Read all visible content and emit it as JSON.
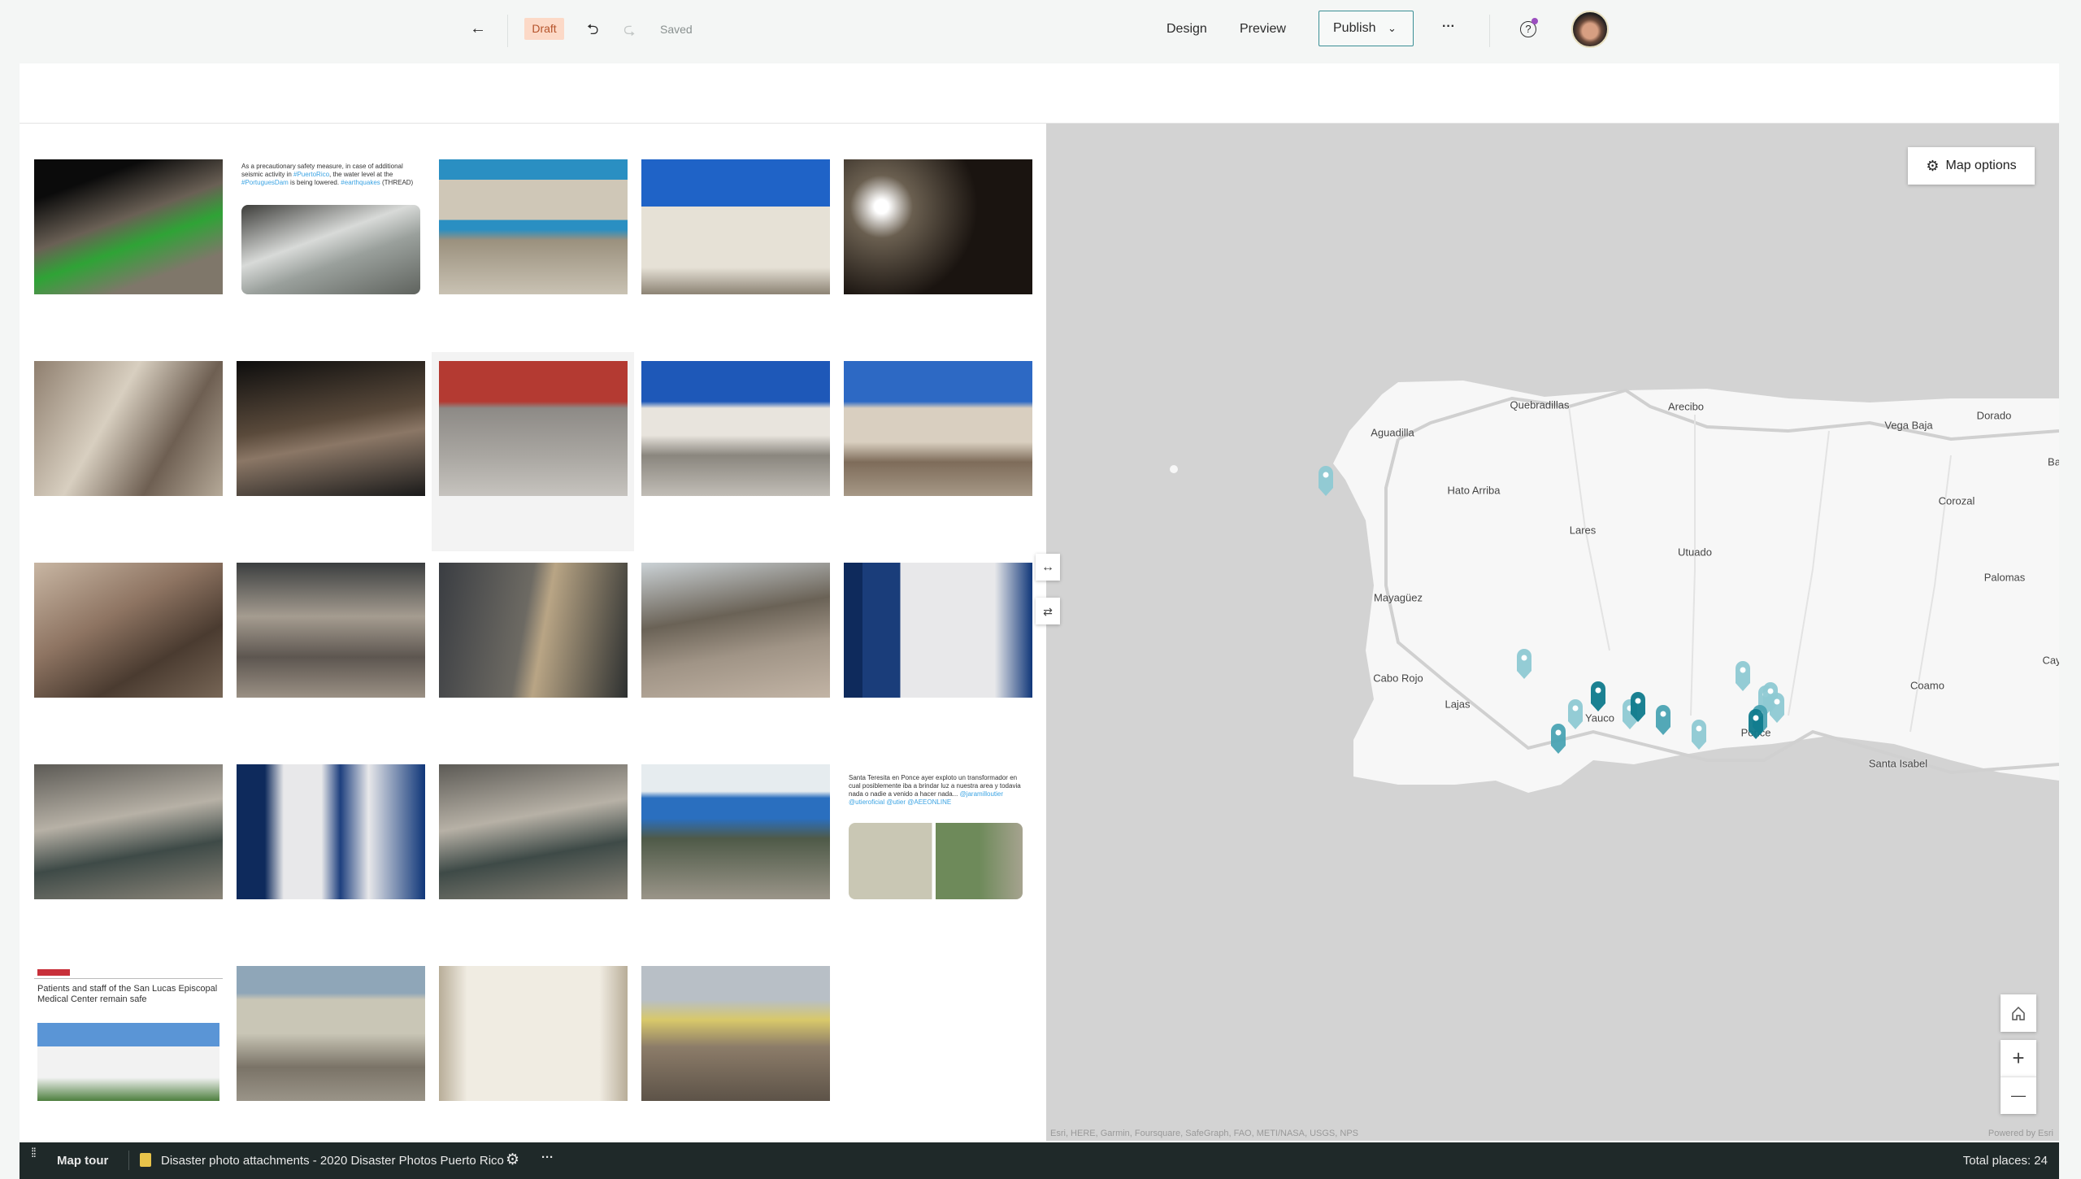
{
  "header": {
    "back_icon": "arrow-left-icon",
    "status_badge": "Draft",
    "undo_icon": "undo-icon",
    "redo_icon": "redo-icon",
    "save_status": "Saved",
    "design_label": "Design",
    "preview_label": "Preview",
    "publish_label": "Publish",
    "publish_chevron": "⌄",
    "more_label": "···",
    "help_icon": "help-icon",
    "avatar_icon": "user-avatar"
  },
  "gallery": {
    "thumbnails": [
      {
        "kind": "photo"
      },
      {
        "kind": "tweet",
        "text_parts": [
          "As a precautionary safety measure, in case of additional seismic activity in ",
          "#PuertoRico",
          ", the water level at the ",
          "#PortuguesDam",
          " is being lowered. ",
          "#earthquakes",
          " (THREAD)"
        ]
      },
      {
        "kind": "photo"
      },
      {
        "kind": "photo"
      },
      {
        "kind": "photo"
      },
      {
        "kind": "photo"
      },
      {
        "kind": "photo"
      },
      {
        "kind": "photo",
        "selected": true
      },
      {
        "kind": "photo"
      },
      {
        "kind": "photo"
      },
      {
        "kind": "photo"
      },
      {
        "kind": "photo"
      },
      {
        "kind": "photo"
      },
      {
        "kind": "photo"
      },
      {
        "kind": "photo"
      },
      {
        "kind": "photo"
      },
      {
        "kind": "photo"
      },
      {
        "kind": "photo"
      },
      {
        "kind": "photo"
      },
      {
        "kind": "tweet",
        "text_parts": [
          "Santa Teresita en Ponce ayer exploto un transformador en cual posiblemente iba a brindar luz a nuestra area y todavia nada o nadie a venido a hacer nada... ",
          "@jaramilloutier @utieroficial @utier @AEEONLINE"
        ]
      },
      {
        "kind": "article",
        "headline": "Patients and staff of the San Lucas Episcopal Medical Center remain safe"
      },
      {
        "kind": "photo"
      },
      {
        "kind": "photo"
      },
      {
        "kind": "photo"
      }
    ],
    "side_buttons": [
      "expand-horizontal-icon",
      "swap-icon"
    ]
  },
  "map": {
    "options_label": "Map options",
    "labels": [
      "Quebradillas",
      "Arecibo",
      "Vega Baja",
      "Dorado",
      "Aguadilla",
      "Hato Arriba",
      "Lares",
      "Utuado",
      "Corozal",
      "Palomas",
      "Mayagüez",
      "Cabo Rojo",
      "Lajas",
      "Yauco",
      "Ponce",
      "Coamo",
      "Santa Isabel",
      "Ba",
      "Cay"
    ],
    "pin_count": 15,
    "pin_colors": {
      "light": "#8ec9d3",
      "medium": "#4aa3b3",
      "dark": "#0f7a8c"
    },
    "attribution": "Esri, HERE, Garmin, Foursquare, SafeGraph, FAO, METI/NASA, USGS, NPS",
    "powered_by": "Powered by Esri",
    "home_icon": "home-icon",
    "zoom_in": "+",
    "zoom_out": "—"
  },
  "footer": {
    "story_type": "Map tour",
    "data_source": "Disaster photo attachments - 2020 Disaster Photos Puerto Rico",
    "more_label": "···",
    "total_places": "Total places: 24"
  }
}
